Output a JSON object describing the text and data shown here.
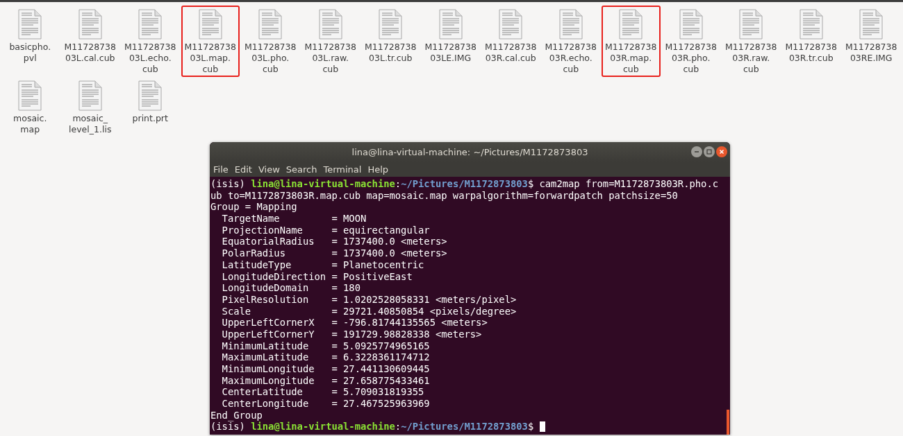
{
  "files": [
    {
      "label_lines": [
        "basicpho.",
        "pvl"
      ],
      "highlighted": false
    },
    {
      "label_lines": [
        "M11728738",
        "03L.cal.cub"
      ],
      "highlighted": false
    },
    {
      "label_lines": [
        "M11728738",
        "03L.echo.",
        "cub"
      ],
      "highlighted": false
    },
    {
      "label_lines": [
        "M11728738",
        "03L.map.",
        "cub"
      ],
      "highlighted": true
    },
    {
      "label_lines": [
        "M11728738",
        "03L.pho.",
        "cub"
      ],
      "highlighted": false
    },
    {
      "label_lines": [
        "M11728738",
        "03L.raw.",
        "cub"
      ],
      "highlighted": false
    },
    {
      "label_lines": [
        "M11728738",
        "03L.tr.cub"
      ],
      "highlighted": false
    },
    {
      "label_lines": [
        "M11728738",
        "03LE.IMG"
      ],
      "highlighted": false
    },
    {
      "label_lines": [
        "M11728738",
        "03R.cal.cub"
      ],
      "highlighted": false
    },
    {
      "label_lines": [
        "M11728738",
        "03R.echo.",
        "cub"
      ],
      "highlighted": false
    },
    {
      "label_lines": [
        "M11728738",
        "03R.map.",
        "cub"
      ],
      "highlighted": true
    },
    {
      "label_lines": [
        "M11728738",
        "03R.pho.",
        "cub"
      ],
      "highlighted": false
    },
    {
      "label_lines": [
        "M11728738",
        "03R.raw.",
        "cub"
      ],
      "highlighted": false
    },
    {
      "label_lines": [
        "M11728738",
        "03R.tr.cub"
      ],
      "highlighted": false
    },
    {
      "label_lines": [
        "M11728738",
        "03RE.IMG"
      ],
      "highlighted": false
    },
    {
      "label_lines": [
        "mosaic.",
        "map"
      ],
      "highlighted": false
    },
    {
      "label_lines": [
        "mosaic_",
        "level_1.lis"
      ],
      "highlighted": false
    },
    {
      "label_lines": [
        "print.prt"
      ],
      "highlighted": false
    }
  ],
  "terminal": {
    "title": "lina@lina-virtual-machine: ~/Pictures/M1172873803",
    "menu": [
      "File",
      "Edit",
      "View",
      "Search",
      "Terminal",
      "Help"
    ],
    "lines": [
      {
        "kind": "prompt",
        "env": "(isis) ",
        "user": "lina@lina-virtual-machine",
        "sep": ":",
        "path": "~/Pictures/M1172873803",
        "command": "$ cam2map from=M1172873803R.pho.c",
        "cursor": false
      },
      {
        "kind": "output",
        "text": "ub to=M1172873803R.map.cub map=mosaic.map warpalgorithm=forwardpatch patchsize=50"
      },
      {
        "kind": "output",
        "text": "Group = Mapping"
      },
      {
        "kind": "output",
        "text": "  TargetName         = MOON"
      },
      {
        "kind": "output",
        "text": "  ProjectionName     = equirectangular"
      },
      {
        "kind": "output",
        "text": "  EquatorialRadius   = 1737400.0 <meters>"
      },
      {
        "kind": "output",
        "text": "  PolarRadius        = 1737400.0 <meters>"
      },
      {
        "kind": "output",
        "text": "  LatitudeType       = Planetocentric"
      },
      {
        "kind": "output",
        "text": "  LongitudeDirection = PositiveEast"
      },
      {
        "kind": "output",
        "text": "  LongitudeDomain    = 180"
      },
      {
        "kind": "output",
        "text": "  PixelResolution    = 1.0202528058331 <meters/pixel>"
      },
      {
        "kind": "output",
        "text": "  Scale              = 29721.40850854 <pixels/degree>"
      },
      {
        "kind": "output",
        "text": "  UpperLeftCornerX   = -796.81744135565 <meters>"
      },
      {
        "kind": "output",
        "text": "  UpperLeftCornerY   = 191729.98828338 <meters>"
      },
      {
        "kind": "output",
        "text": "  MinimumLatitude    = 5.0925774965165"
      },
      {
        "kind": "output",
        "text": "  MaximumLatitude    = 6.3228361174712"
      },
      {
        "kind": "output",
        "text": "  MinimumLongitude   = 27.441130609445"
      },
      {
        "kind": "output",
        "text": "  MaximumLongitude   = 27.658775433461"
      },
      {
        "kind": "output",
        "text": "  CenterLatitude     = 5.709031819355"
      },
      {
        "kind": "output",
        "text": "  CenterLongitude    = 27.467525963969"
      },
      {
        "kind": "output",
        "text": "End_Group"
      },
      {
        "kind": "prompt",
        "env": "(isis) ",
        "user": "lina@lina-virtual-machine",
        "sep": ":",
        "path": "~/Pictures/M1172873803",
        "command": "$ ",
        "cursor": true
      }
    ]
  }
}
